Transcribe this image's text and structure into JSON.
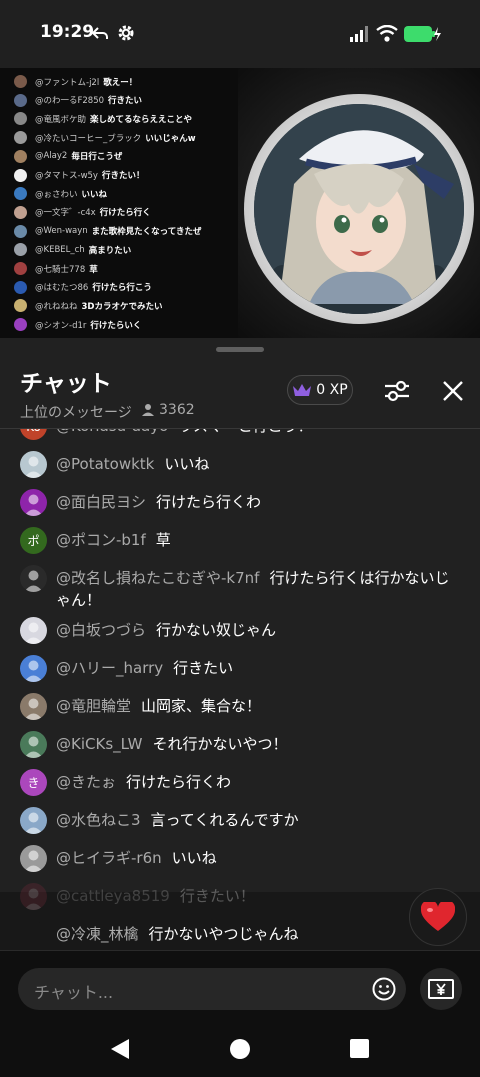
{
  "status_bar": {
    "time": "19:29"
  },
  "video_chat": [
    {
      "user": "@ファントム-j2l",
      "msg": "歌えー！",
      "color": "#7a5a4a"
    },
    {
      "user": "@のわ一るF2850",
      "msg": "行きたい",
      "color": "#5a6a8a"
    },
    {
      "user": "@竜風ボケ助",
      "msg": "楽しめてるならええことや",
      "color": "#888888"
    },
    {
      "user": "@冷たいコーヒー_ブラック",
      "msg": "いいじゃんw",
      "color": "#9a9a9a"
    },
    {
      "user": "@Alay2",
      "msg": "毎日行こうぜ",
      "color": "#a08060"
    },
    {
      "user": "@タマトス-w5y",
      "msg": "行きたい！",
      "color": "#f0f0f0"
    },
    {
      "user": "@ぉさわい",
      "msg": "いいね",
      "color": "#3a7ac0"
    },
    {
      "user": "@一文字゛-c4x",
      "msg": "行けたら行く",
      "color": "#c0a090"
    },
    {
      "user": "@Wen-wayn",
      "msg": "また歌枠見たくなってきたぜ",
      "color": "#6a8aa8"
    },
    {
      "user": "@KEBEL_ch",
      "msg": "高まりたい",
      "color": "#9aa0a8"
    },
    {
      "user": "@七騎士778",
      "msg": "草",
      "color": "#a04040"
    },
    {
      "user": "@はむたつ86",
      "msg": "行けたら行こう",
      "color": "#2a5ab0"
    },
    {
      "user": "@れねねね",
      "msg": "3Dカラオケでみたい",
      "color": "#c8b070"
    },
    {
      "user": "@シオン-d1r",
      "msg": "行けたらいく",
      "color": "#9a40c0"
    }
  ],
  "sheet": {
    "title": "チャット",
    "subtitle": "上位のメッセージ",
    "viewers": "3362",
    "xp": "0 XP"
  },
  "messages": [
    {
      "user": "@Korlasu-dayo",
      "text": "ラスマ一と行こう！",
      "initial": "Ko",
      "color": "#c0432a"
    },
    {
      "user": "@Potatowktk",
      "text": "いいね",
      "initial": "",
      "color": "#b8c8d0"
    },
    {
      "user": "@面白民ヨシ",
      "text": "行けたら行くわ",
      "initial": "",
      "color": "#8e24aa"
    },
    {
      "user": "@ポコン-b1f",
      "text": "草",
      "initial": "ポ",
      "color": "#33691e"
    },
    {
      "user": "@改名し損ねたこむぎや-k7nf",
      "text": "行けたら行くは行かないじゃん！",
      "initial": "",
      "color": "#2a2a2a"
    },
    {
      "user": "@白坂つづら",
      "text": "行かない奴じゃん",
      "initial": "",
      "color": "#d8d8e0"
    },
    {
      "user": "@ハリー_harry",
      "text": "行きたい",
      "initial": "",
      "color": "#4a7fd6"
    },
    {
      "user": "@竜胆輪堂",
      "text": "山岡家、集合な！",
      "initial": "",
      "color": "#8a7a6a"
    },
    {
      "user": "@KiCKs_LW",
      "text": "それ行かないやつ！",
      "initial": "",
      "color": "#4a7a5a"
    },
    {
      "user": "@きたぉ",
      "text": "行けたら行くわ",
      "initial": "き",
      "color": "#ab47bc"
    },
    {
      "user": "@水色ねこ3",
      "text": "言ってくれるんですか",
      "initial": "",
      "color": "#8aa8c8"
    },
    {
      "user": "@ヒイラギ-r6n",
      "text": "いいね",
      "initial": "",
      "color": "#9a9a9a"
    },
    {
      "user": "@cattleya8519",
      "text": "行きたい！",
      "initial": "",
      "color": "#7a2a3a"
    },
    {
      "user": "@冷凍_林檎",
      "text": "行かないやつじゃんね",
      "initial": "",
      "color": "#181818"
    }
  ],
  "input": {
    "placeholder": "チャット..."
  },
  "icons": {
    "back_arrow": "back-arrow-icon",
    "settings": "gear-icon",
    "crown": "crown-icon",
    "heart": "heart-icon"
  }
}
